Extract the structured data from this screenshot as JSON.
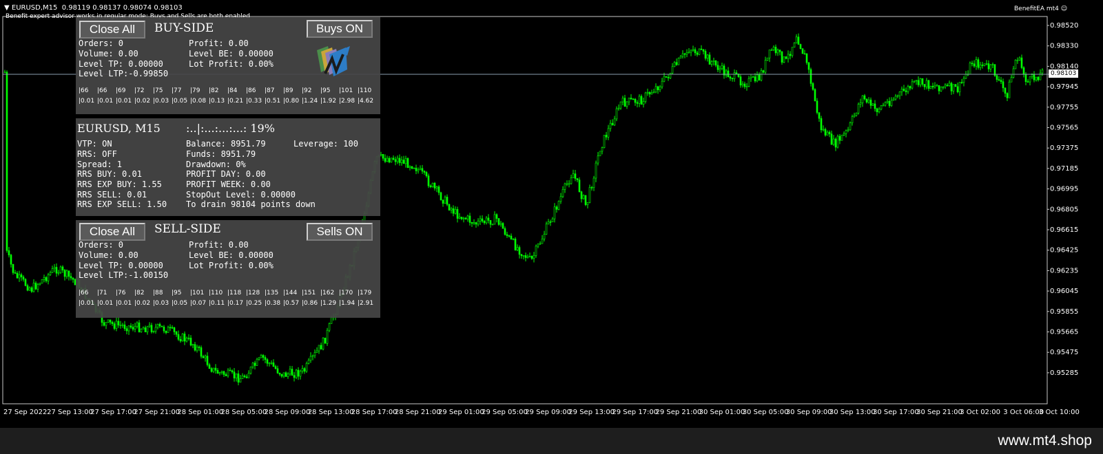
{
  "window": {
    "title": "EURUSD,M15",
    "ohlc": "0.98119 0.98137 0.98074 0.98103",
    "status": "Benefit expert advisor works in regular mode: Buys and Sells are both enabled",
    "ea_name": "BenefitEA mt4"
  },
  "current_price": "0.98103",
  "price_axis": [
    "0.98520",
    "0.98330",
    "0.98140",
    "0.97945",
    "0.97755",
    "0.97565",
    "0.97375",
    "0.97185",
    "0.96995",
    "0.96805",
    "0.96615",
    "0.96425",
    "0.96235",
    "0.96045",
    "0.95855",
    "0.95665",
    "0.95475",
    "0.95285"
  ],
  "time_axis": [
    "27 Sep 2022",
    "27 Sep 13:00",
    "27 Sep 17:00",
    "27 Sep 21:00",
    "28 Sep 01:00",
    "28 Sep 05:00",
    "28 Sep 09:00",
    "28 Sep 13:00",
    "28 Sep 17:00",
    "28 Sep 21:00",
    "29 Sep 01:00",
    "29 Sep 05:00",
    "29 Sep 09:00",
    "29 Sep 13:00",
    "29 Sep 17:00",
    "29 Sep 21:00",
    "30 Sep 01:00",
    "30 Sep 05:00",
    "30 Sep 09:00",
    "30 Sep 13:00",
    "30 Sep 17:00",
    "30 Sep 21:00",
    "3 Oct 02:00",
    "3 Oct 06:00",
    "3 Oct 10:00"
  ],
  "buy_side": {
    "close_label": "Close All",
    "title": "BUY-SIDE",
    "toggle_label": "Buys ON",
    "orders": "Orders: 0",
    "volume": "Volume: 0.00",
    "level_tp": "Level TP: 0.00000",
    "level_ltp": "Level LTP:-0.99850",
    "profit": "Profit: 0.00",
    "level_be": "Level BE: 0.00000",
    "lot_profit": "Lot Profit: 0.00%",
    "ladder_top": [
      "|66",
      "|66",
      "|69",
      "|72",
      "|75",
      "|77",
      "|79",
      "|82",
      "|84",
      "|86",
      "|87",
      "|89",
      "|92",
      "|95",
      "|101",
      "|110"
    ],
    "ladder_bottom": [
      "|0.01",
      "|0.01",
      "|0.01",
      "|0.02",
      "|0.03",
      "|0.05",
      "|0.08",
      "|0.13",
      "|0.21",
      "|0.33",
      "|0.51",
      "|0.80",
      "|1.24",
      "|1.92",
      "|2.98",
      "|4.62"
    ]
  },
  "account": {
    "symbol": "EURUSD, M15",
    "progress_text": ":..|:...:...:...: 19%",
    "vtp": "VTP: ON",
    "rrs": "RRS: OFF",
    "spread": "Spread: 1",
    "rrs_buy": "RRS BUY: 0.01",
    "rrs_exp_buy": "RRS EXP BUY: 1.55",
    "rrs_sell": "RRS SELL: 0.01",
    "rrs_exp_sell": "RRS EXP SELL: 1.50",
    "balance": "Balance: 8951.79",
    "funds": "Funds: 8951.79",
    "drawdown": "Drawdown: 0%",
    "profit_day": "PROFIT DAY: 0.00",
    "profit_week": "PROFIT WEEK: 0.00",
    "stopout": "StopOut Level: 0.00000",
    "drain": "To drain 98104 points down",
    "leverage": "Leverage: 100"
  },
  "sell_side": {
    "close_label": "Close All",
    "title": "SELL-SIDE",
    "toggle_label": "Sells ON",
    "orders": "Orders: 0",
    "volume": "Volume: 0.00",
    "level_tp": "Level TP: 0.00000",
    "level_ltp": "Level LTP:-1.00150",
    "profit": "Profit: 0.00",
    "level_be": "Level BE: 0.00000",
    "lot_profit": "Lot Profit: 0.00%",
    "ladder_top": [
      "|66",
      "|71",
      "|76",
      "|82",
      "|88",
      "|95",
      "|101",
      "|110",
      "|118",
      "|128",
      "|135",
      "|144",
      "|151",
      "|162",
      "|170",
      "|179"
    ],
    "ladder_bottom": [
      "|0.01",
      "|0.01",
      "|0.01",
      "|0.02",
      "|0.03",
      "|0.05",
      "|0.07",
      "|0.11",
      "|0.17",
      "|0.25",
      "|0.38",
      "|0.57",
      "|0.86",
      "|1.29",
      "|1.94",
      "|2.91"
    ]
  },
  "watermark": "www.mt4.shop",
  "colors": {
    "candle": "#00ff00",
    "background": "#000000",
    "panel": "#464646",
    "price_line": "#8aa0b0"
  }
}
